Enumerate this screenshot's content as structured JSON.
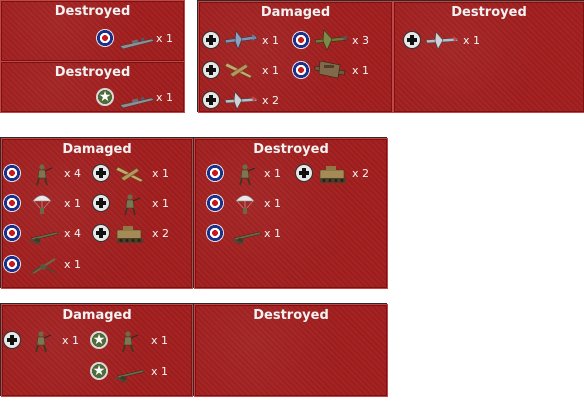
{
  "reports": [
    {
      "id": "r1",
      "sections": [
        {
          "title": "Destroyed"
        },
        {
          "title": "Destroyed"
        }
      ]
    },
    {
      "id": "r2",
      "sections": [
        {
          "title": "Damaged"
        },
        {
          "title": "Destroyed"
        }
      ]
    },
    {
      "id": "r3",
      "sections": [
        {
          "title": "Damaged"
        },
        {
          "title": "Destroyed"
        }
      ]
    },
    {
      "id": "r4",
      "sections": [
        {
          "title": "Damaged"
        },
        {
          "title": "Destroyed"
        }
      ]
    }
  ],
  "entries": [
    {
      "key": "r1s1a",
      "nation": "uk",
      "unit": "warship",
      "count": "x 1"
    },
    {
      "key": "r1s2a",
      "nation": "us",
      "unit": "warship",
      "count": "x 1"
    },
    {
      "key": "r2s1a",
      "nation": "de",
      "unit": "fighter-blue",
      "count": "x 1"
    },
    {
      "key": "r2s1b",
      "nation": "uk",
      "unit": "fighter-green",
      "count": "x 3"
    },
    {
      "key": "r2s1c",
      "nation": "de",
      "unit": "fighter-tan",
      "count": "x 1"
    },
    {
      "key": "r2s1d",
      "nation": "uk",
      "unit": "bomber-brown",
      "count": "x 1"
    },
    {
      "key": "r2s1e",
      "nation": "de",
      "unit": "fighter-grey",
      "count": "x 2"
    },
    {
      "key": "r2s2a",
      "nation": "de",
      "unit": "fighter-grey",
      "count": "x 1"
    },
    {
      "key": "r3s1a",
      "nation": "uk",
      "unit": "infantry",
      "count": "x 4"
    },
    {
      "key": "r3s1b",
      "nation": "de",
      "unit": "fighter-tan",
      "count": "x 1"
    },
    {
      "key": "r3s1c",
      "nation": "uk",
      "unit": "paratrooper",
      "count": "x 1"
    },
    {
      "key": "r3s1d",
      "nation": "de",
      "unit": "infantry",
      "count": "x 1"
    },
    {
      "key": "r3s1e",
      "nation": "uk",
      "unit": "artillery",
      "count": "x 4"
    },
    {
      "key": "r3s1f",
      "nation": "de",
      "unit": "halftrack",
      "count": "x 2"
    },
    {
      "key": "r3s1g",
      "nation": "uk",
      "unit": "aa-gun",
      "count": "x 1"
    },
    {
      "key": "r3s2a",
      "nation": "uk",
      "unit": "infantry",
      "count": "x 1"
    },
    {
      "key": "r3s2b",
      "nation": "de",
      "unit": "halftrack",
      "count": "x 2"
    },
    {
      "key": "r3s2c",
      "nation": "uk",
      "unit": "paratrooper",
      "count": "x 1"
    },
    {
      "key": "r3s2d",
      "nation": "uk",
      "unit": "artillery",
      "count": "x 1"
    },
    {
      "key": "r4s1a",
      "nation": "de",
      "unit": "infantry",
      "count": "x 1"
    },
    {
      "key": "r4s1b",
      "nation": "us",
      "unit": "infantry",
      "count": "x 1"
    },
    {
      "key": "r4s1c",
      "nation": "us",
      "unit": "artillery",
      "count": "x 1"
    }
  ],
  "icons": {
    "uk": "raf-roundel-icon",
    "de": "iron-cross-roundel-icon",
    "us": "white-star-roundel-icon",
    "star_glyph": "★"
  },
  "colors": {
    "panel": "#a31f1f",
    "text": "#f2f2f2"
  }
}
